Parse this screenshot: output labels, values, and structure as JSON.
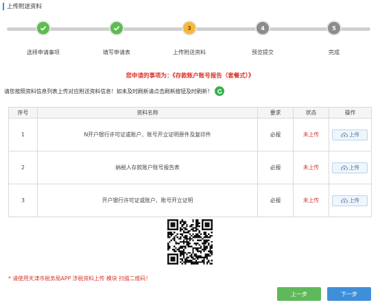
{
  "header": {
    "title": "上传附送资料"
  },
  "steps": [
    {
      "number": "1",
      "label": "选择申请事项",
      "state": "done"
    },
    {
      "number": "2",
      "label": "填写申请表",
      "state": "done"
    },
    {
      "number": "3",
      "label": "上传附送资料",
      "state": "current"
    },
    {
      "number": "4",
      "label": "预览提交",
      "state": "todo"
    },
    {
      "number": "5",
      "label": "完成",
      "state": "todo"
    }
  ],
  "matter": {
    "text": "您申请的事项为：《存款账户账号报告（套餐式）》"
  },
  "notice": {
    "text": "请您按照资料信息列表上传对应附送资料信息！如未及时刷新请点击刷新按钮及时刷新！"
  },
  "table": {
    "headers": [
      "序号",
      "资料名称",
      "要求",
      "状态",
      "操作"
    ],
    "rows": [
      {
        "index": "1",
        "name": "N开户银行许可证或账户、账号开立证明原件及复印件",
        "requirement": "必报",
        "status": "未上传",
        "action": "上传"
      },
      {
        "index": "2",
        "name": "纳税人存款账户账号报告表",
        "requirement": "必报",
        "status": "未上传",
        "action": "上传"
      },
      {
        "index": "3",
        "name": "开户银行许可证或账户、账号开立证明",
        "requirement": "必报",
        "status": "未上传",
        "action": "上传"
      }
    ]
  },
  "scan_tip": "* 请使用天津市税务局APP 涉税资料上传 模块 扫描二维码！",
  "buttons": {
    "prev": "上一步",
    "next": "下一步"
  },
  "colors": {
    "done": "#5cbd4f",
    "current": "#f5b83d",
    "todo": "#8c8c8c",
    "alert": "#d9342b",
    "primary": "#3e8fd8",
    "success": "#5fb85a"
  }
}
